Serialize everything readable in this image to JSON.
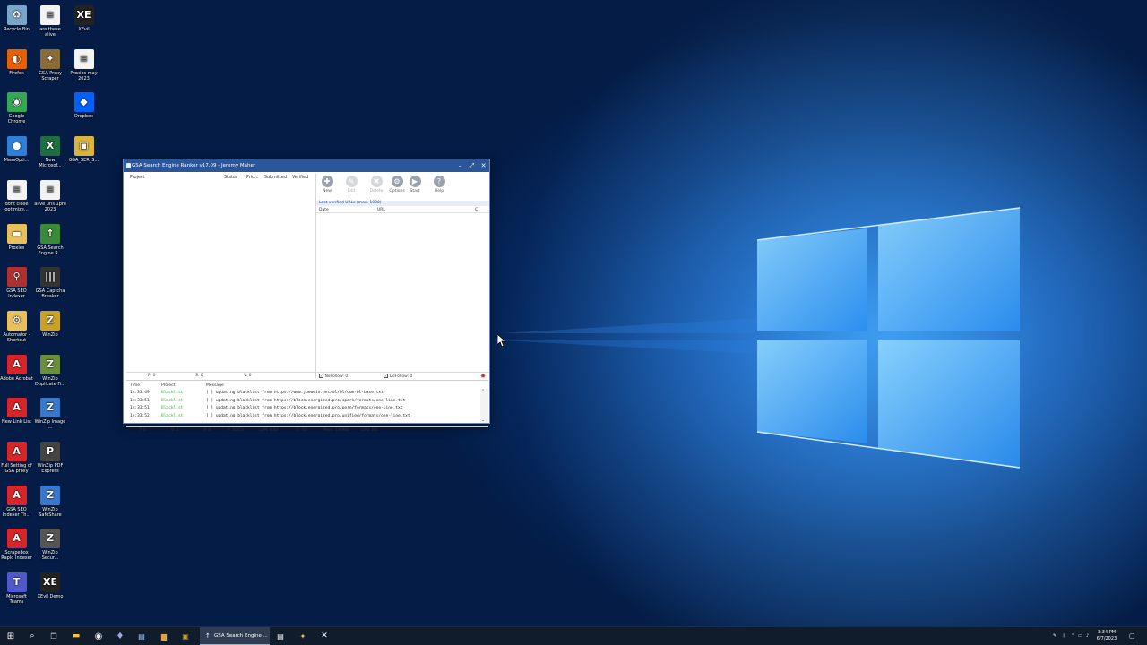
{
  "desktop": {
    "icons": [
      {
        "label": "Recycle Bin",
        "icon": "recycle-bin-icon",
        "color": "#7aa6c9"
      },
      {
        "label": "are these alive",
        "icon": "text-file-icon",
        "color": "#f3f3f3"
      },
      {
        "label": "XEvil",
        "icon": "xevil-icon",
        "color": "#222222"
      },
      {
        "label": "Firefox",
        "icon": "firefox-icon",
        "color": "#e66000"
      },
      {
        "label": "GSA Proxy Scraper",
        "icon": "gsa-proxy-scraper-icon",
        "color": "#8a6b3a"
      },
      {
        "label": "Proxies may 2023",
        "icon": "text-file-icon",
        "color": "#f3f3f3"
      },
      {
        "label": "Google Chrome",
        "icon": "chrome-icon",
        "color": "#34a853"
      },
      {
        "label": "Dropbox",
        "icon": "dropbox-icon",
        "color": "#0061ff"
      },
      {
        "label": "MassOpti...",
        "icon": "massoptimizer-icon",
        "color": "#2f7fd6"
      },
      {
        "label": "New Microsof...",
        "icon": "excel-icon",
        "color": "#1d6f42"
      },
      {
        "label": "GSA_SER_S...",
        "icon": "archive-icon",
        "color": "#d9b43c"
      },
      {
        "label": "dont close optimize...",
        "icon": "text-file-icon",
        "color": "#f3f3f3"
      },
      {
        "label": "alive urls 1pril 2023",
        "icon": "text-file-icon",
        "color": "#f3f3f3"
      },
      {
        "label": "Proxies",
        "icon": "folder-icon",
        "color": "#e8c15a"
      },
      {
        "label": "GSA Search Engine R...",
        "icon": "gsa-ser-icon",
        "color": "#3a8a3a"
      },
      {
        "label": "GSA SEO Indexer",
        "icon": "gsa-seo-indexer-icon",
        "color": "#b03030"
      },
      {
        "label": "GSA Captcha Breaker",
        "icon": "captcha-breaker-icon",
        "color": "#333333"
      },
      {
        "label": "Automator - Shortcut",
        "icon": "automator-icon",
        "color": "#e8c15a"
      },
      {
        "label": "WinZip",
        "icon": "winzip-icon",
        "color": "#c9a227"
      },
      {
        "label": "Adobe Acrobat",
        "icon": "acrobat-icon",
        "color": "#d7262b"
      },
      {
        "label": "WinZip Duplicate Fi...",
        "icon": "winzip-duplicate-icon",
        "color": "#6b8f3a"
      },
      {
        "label": "New Link List",
        "icon": "pdf-icon",
        "color": "#d7262b"
      },
      {
        "label": "WinZip Image ...",
        "icon": "winzip-image-icon",
        "color": "#3a78c9"
      },
      {
        "label": "Full Setting of GSA proxy",
        "icon": "pdf-icon",
        "color": "#d7262b"
      },
      {
        "label": "WinZip PDF Express",
        "icon": "winzip-pdf-icon",
        "color": "#444444"
      },
      {
        "label": "GSA SEO Indexer Th...",
        "icon": "pdf-icon",
        "color": "#d7262b"
      },
      {
        "label": "WinZip SafeShare",
        "icon": "winzip-safeshare-icon",
        "color": "#3a78c9"
      },
      {
        "label": "Scrapebox Rapid Indexer",
        "icon": "pdf-icon",
        "color": "#d7262b"
      },
      {
        "label": "WinZip Secur...",
        "icon": "winzip-secure-icon",
        "color": "#555555"
      },
      {
        "label": "Microsoft Teams",
        "icon": "teams-icon",
        "color": "#5059c9"
      },
      {
        "label": "XEvil Demo",
        "icon": "xevil-icon",
        "color": "#222222"
      }
    ]
  },
  "window": {
    "title": "GSA Search Engine Ranker v17.09 - Jeremy Maher",
    "minimize": "–",
    "maximize": "⤢",
    "close": "✕",
    "project_columns": [
      "Project",
      "Status",
      "Prio...",
      "Submitted",
      "Verified"
    ],
    "left_status": {
      "p": "P: 0",
      "s": "S: 0",
      "v": "V: 0"
    },
    "toolbar": [
      {
        "label": "New",
        "icon": "new-project-icon",
        "glyph": "✚",
        "enabled": true
      },
      {
        "label": "Edit",
        "icon": "edit-icon",
        "glyph": "✎",
        "enabled": false
      },
      {
        "label": "Delete",
        "icon": "delete-icon",
        "glyph": "✖",
        "enabled": false
      },
      {
        "label": "Options",
        "icon": "options-icon",
        "glyph": "⚙",
        "enabled": true
      },
      {
        "label": "Start",
        "icon": "start-icon",
        "glyph": "▶",
        "enabled": true
      },
      {
        "label": "Help",
        "icon": "help-icon",
        "glyph": "?",
        "enabled": true
      }
    ],
    "verified_header": "Last verified URLs (max. 1000)",
    "verified_columns": [
      "Date",
      "URL",
      "C"
    ],
    "nofollow": {
      "label": "NoFollow: 0",
      "checked": true
    },
    "dofollow": {
      "label": "DoFollow: 0",
      "checked": true
    },
    "log_columns": [
      "Time",
      "Project",
      "Message"
    ],
    "log_rows": [
      {
        "time": "14:33:49",
        "project": "Blacklist",
        "message": "[ ] updating blacklist from https://www.joewein.net/dl/bl/dom-bl-base.txt"
      },
      {
        "time": "14:33:51",
        "project": "Blacklist",
        "message": "[ ] updating blacklist from https://block.energized.pro/spark/formats/one-line.txt"
      },
      {
        "time": "14:33:51",
        "project": "Blacklist",
        "message": "[ ] updating blacklist from https://block.energized.pro/porn/formats/one-line.txt"
      },
      {
        "time": "14:33:52",
        "project": "Blacklist",
        "message": "[ ] updating blacklist from https://block.energized.pro/unified/formats/one-line.txt"
      }
    ],
    "bottom_status": [
      "T: 0",
      "S: 0",
      "V: 0",
      "P: 10|53",
      "LpM: 0.00",
      "C: 0|2",
      "Mem: 180MB",
      "CPU: 0%"
    ]
  },
  "taskbar": {
    "active_label": "GSA Search Engine ...",
    "clock_time": "3:34 PM",
    "clock_date": "6/7/2023"
  },
  "colors": {
    "accent": "#2b579a",
    "log_tag": "#3cb043",
    "taskbar": "#101b2c"
  }
}
